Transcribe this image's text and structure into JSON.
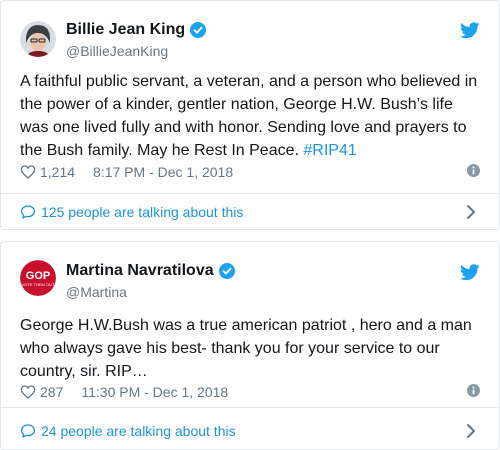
{
  "tweets": [
    {
      "name": "Billie Jean King",
      "handle": "@BillieJeanKing",
      "text": "A faithful public servant, a veteran, and a person who believed in the power of a kinder, gentler nation, George H.W. Bush’s life was one lived fully and with honor. Sending love and prayers to the Bush family. May he Rest In Peace. ",
      "hashtag": "#RIP41",
      "likes": "1,214",
      "timestamp": "8:17 PM - Dec 1, 2018",
      "talking": "125 people are talking about this"
    },
    {
      "name": "Martina Navratilova",
      "handle": "@Martina",
      "avatar_text": "VOTE THEM OUT",
      "text": "George H.W.Bush was a true american patriot , hero and a man who always gave his best- thank you for your service to our country, sir. RIP…",
      "likes": "287",
      "timestamp": "11:30 PM - Dec 1, 2018",
      "talking": "24 people are talking about this"
    }
  ],
  "colors": {
    "link": "#1b95e0",
    "muted": "#657786",
    "border": "#e1e8ed",
    "twitter_blue": "#1da1f2"
  }
}
